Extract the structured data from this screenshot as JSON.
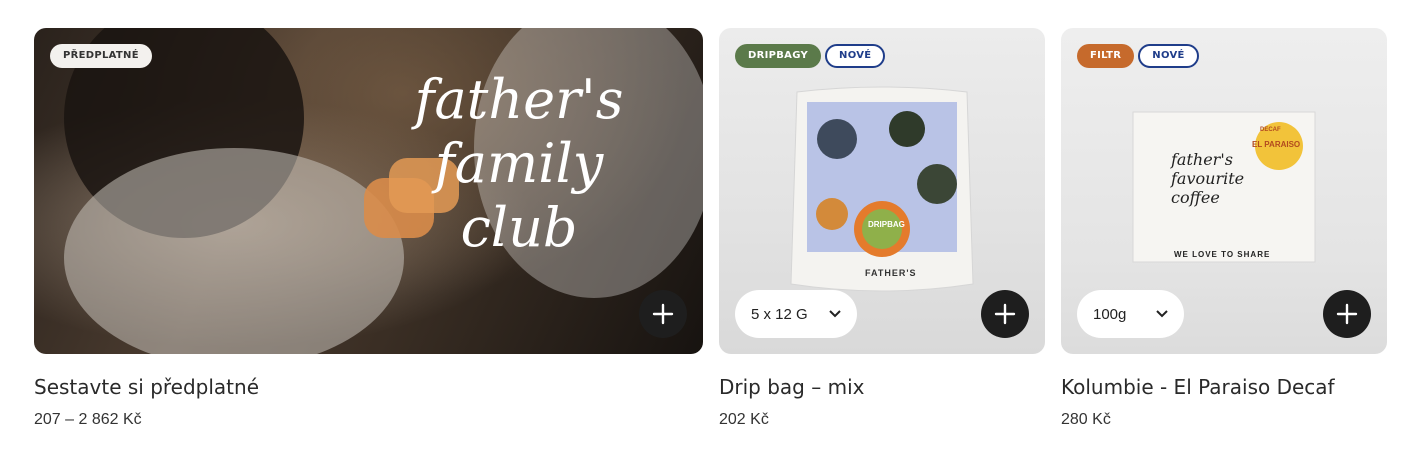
{
  "products": [
    {
      "badges": [
        "PŘEDPLATNÉ"
      ],
      "image_script": "father's family club",
      "title": "Sestavte si předplatné",
      "price": "207 – 2 862 Kč"
    },
    {
      "badges": [
        "DRIPBAGY",
        "NOVÉ"
      ],
      "package_label": "DRIPBAG",
      "package_brand": "FATHER'S",
      "variant": "5 x 12 G",
      "title": "Drip bag – mix",
      "price": "202 Kč"
    },
    {
      "badges": [
        "FILTR",
        "NOVÉ"
      ],
      "sticker_top": "DECAF",
      "sticker_main": "EL PARAISO",
      "box_script": "father's favourite coffee",
      "box_footer": "WE LOVE TO SHARE",
      "variant": "100g",
      "title": "Kolumbie - El Paraiso Decaf",
      "price": "280 Kč"
    }
  ],
  "colors": {
    "add_button": "#1e1e1e",
    "badge_green": "#5b7a4a",
    "badge_orange": "#c66a2c",
    "badge_outline": "#1f3d8a"
  },
  "icons": [
    "plus-icon",
    "chevron-down-icon"
  ]
}
